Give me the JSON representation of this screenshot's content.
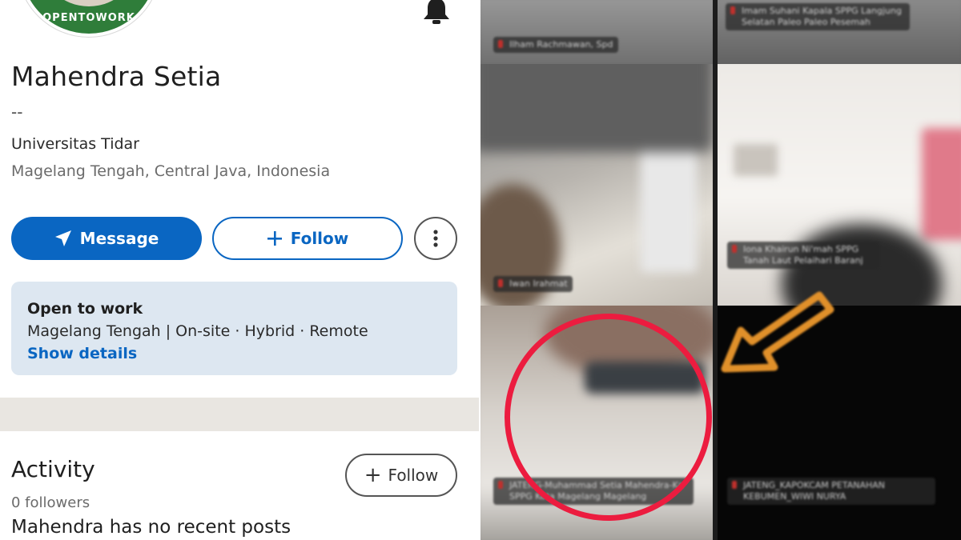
{
  "profile": {
    "avatar_frame_text": "OPENTOWORK",
    "name": "Mahendra Setia",
    "headline": "--",
    "school": "Universitas Tidar",
    "location": "Magelang Tengah, Central Java, Indonesia"
  },
  "actions": {
    "message_label": "Message",
    "follow_label": "Follow",
    "more_icon": "more-vertical-icon"
  },
  "open_to_work": {
    "title": "Open to work",
    "detail": "Magelang Tengah | On-site · Hybrid · Remote",
    "link": "Show details"
  },
  "activity": {
    "title": "Activity",
    "followers": "0 followers",
    "follow_label": "Follow",
    "empty_text": "Mahendra has no recent posts"
  },
  "call_tiles": [
    {
      "label": "Ilham Rachmawan, Spd"
    },
    {
      "label": "Imam Suhani Kapala SPPG Langjung Selatan Paleo Paleo Pesemah"
    },
    {
      "label": "Iwan Irahmat"
    },
    {
      "label": "Iona Khairun Ni'mah SPPG Tanah Laut Pelaihari Baranj"
    },
    {
      "label": "JATENG-Muhammad Setia Mahendra-Ka SPPG Kota Magelang Magelang"
    },
    {
      "label": "JATENG_KAPOKCAM PETANAHAN KEBUMEN_WIWI NURYA"
    }
  ],
  "colors": {
    "brand_blue": "#0a66c2",
    "open_to_work_bg": "#dde7f1",
    "highlight_circle": "#ec1c3f",
    "arrow": "#e0902a"
  }
}
